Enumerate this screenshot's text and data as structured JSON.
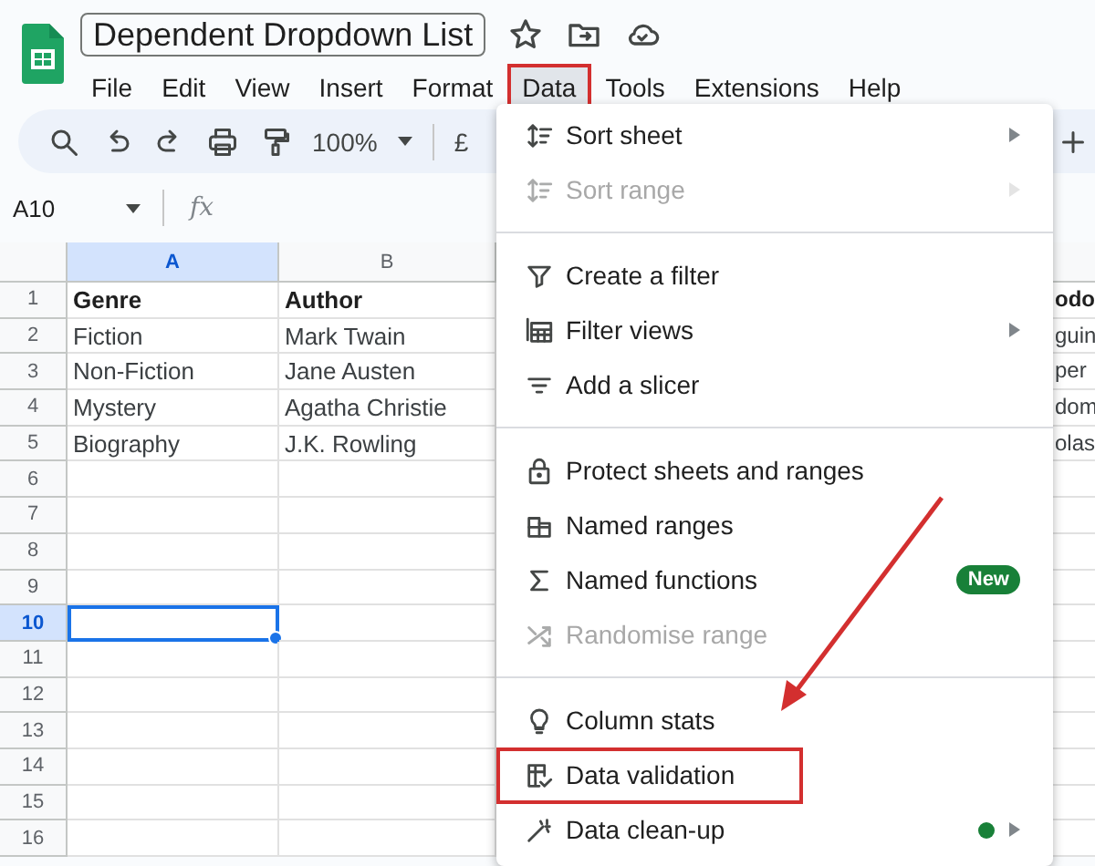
{
  "app": {
    "title": "Dependent Dropdown List"
  },
  "menu_bar": [
    {
      "label": "File",
      "selected": false,
      "highlighted": false
    },
    {
      "label": "Edit",
      "selected": false,
      "highlighted": false
    },
    {
      "label": "View",
      "selected": false,
      "highlighted": false
    },
    {
      "label": "Insert",
      "selected": false,
      "highlighted": false
    },
    {
      "label": "Format",
      "selected": false,
      "highlighted": false
    },
    {
      "label": "Data",
      "selected": true,
      "highlighted": true
    },
    {
      "label": "Tools",
      "selected": false,
      "highlighted": false
    },
    {
      "label": "Extensions",
      "selected": false,
      "highlighted": false
    },
    {
      "label": "Help",
      "selected": false,
      "highlighted": false
    }
  ],
  "toolbar": {
    "zoom": "100%",
    "currency": "£"
  },
  "formula_bar": {
    "name_box": "A10",
    "formula_label": "fx"
  },
  "columns": [
    {
      "label": "A",
      "selected": true
    },
    {
      "label": "B",
      "selected": false
    }
  ],
  "rows": [
    {
      "number": "1",
      "selected": false,
      "cells": [
        "Genre",
        "Author",
        "odo"
      ]
    },
    {
      "number": "2",
      "selected": false,
      "cells": [
        "Fiction",
        "Mark Twain",
        "guin"
      ]
    },
    {
      "number": "3",
      "selected": false,
      "cells": [
        "Non-Fiction",
        "Jane Austen",
        "per"
      ]
    },
    {
      "number": "4",
      "selected": false,
      "cells": [
        "Mystery",
        "Agatha Christie",
        "dom"
      ]
    },
    {
      "number": "5",
      "selected": false,
      "cells": [
        "Biography",
        "J.K. Rowling",
        "olas"
      ]
    },
    {
      "number": "6",
      "selected": false
    },
    {
      "number": "7",
      "selected": false
    },
    {
      "number": "8",
      "selected": false
    },
    {
      "number": "9",
      "selected": false
    },
    {
      "number": "10",
      "selected": true
    },
    {
      "number": "11",
      "selected": false
    },
    {
      "number": "12",
      "selected": false
    },
    {
      "number": "13",
      "selected": false
    },
    {
      "number": "14",
      "selected": false
    },
    {
      "number": "15",
      "selected": false
    },
    {
      "number": "16",
      "selected": false
    }
  ],
  "data_menu": {
    "sections": [
      [
        {
          "label": "Sort sheet",
          "disabled": false,
          "submenu": true,
          "dot": false,
          "highlighted": false
        },
        {
          "label": "Sort range",
          "disabled": true,
          "submenu": true,
          "dot": false,
          "highlighted": false
        }
      ],
      [
        {
          "label": "Create a filter",
          "disabled": false,
          "submenu": false,
          "dot": false,
          "highlighted": false
        },
        {
          "label": "Filter views",
          "disabled": false,
          "submenu": true,
          "dot": false,
          "highlighted": false
        },
        {
          "label": "Add a slicer",
          "disabled": false,
          "submenu": false,
          "dot": false,
          "highlighted": false
        }
      ],
      [
        {
          "label": "Protect sheets and ranges",
          "disabled": false,
          "submenu": false,
          "dot": false,
          "highlighted": false
        },
        {
          "label": "Named ranges",
          "disabled": false,
          "submenu": false,
          "dot": false,
          "highlighted": false
        },
        {
          "label": "Named functions",
          "disabled": false,
          "submenu": false,
          "dot": false,
          "highlighted": false,
          "badge": "New"
        },
        {
          "label": "Randomise range",
          "disabled": true,
          "submenu": false,
          "dot": false,
          "highlighted": false
        }
      ],
      [
        {
          "label": "Column stats",
          "disabled": false,
          "submenu": false,
          "dot": false,
          "highlighted": false
        },
        {
          "label": "Data validation",
          "disabled": false,
          "submenu": false,
          "dot": false,
          "highlighted": true
        },
        {
          "label": "Data clean-up",
          "disabled": false,
          "submenu": true,
          "dot": true,
          "highlighted": false
        }
      ]
    ]
  }
}
